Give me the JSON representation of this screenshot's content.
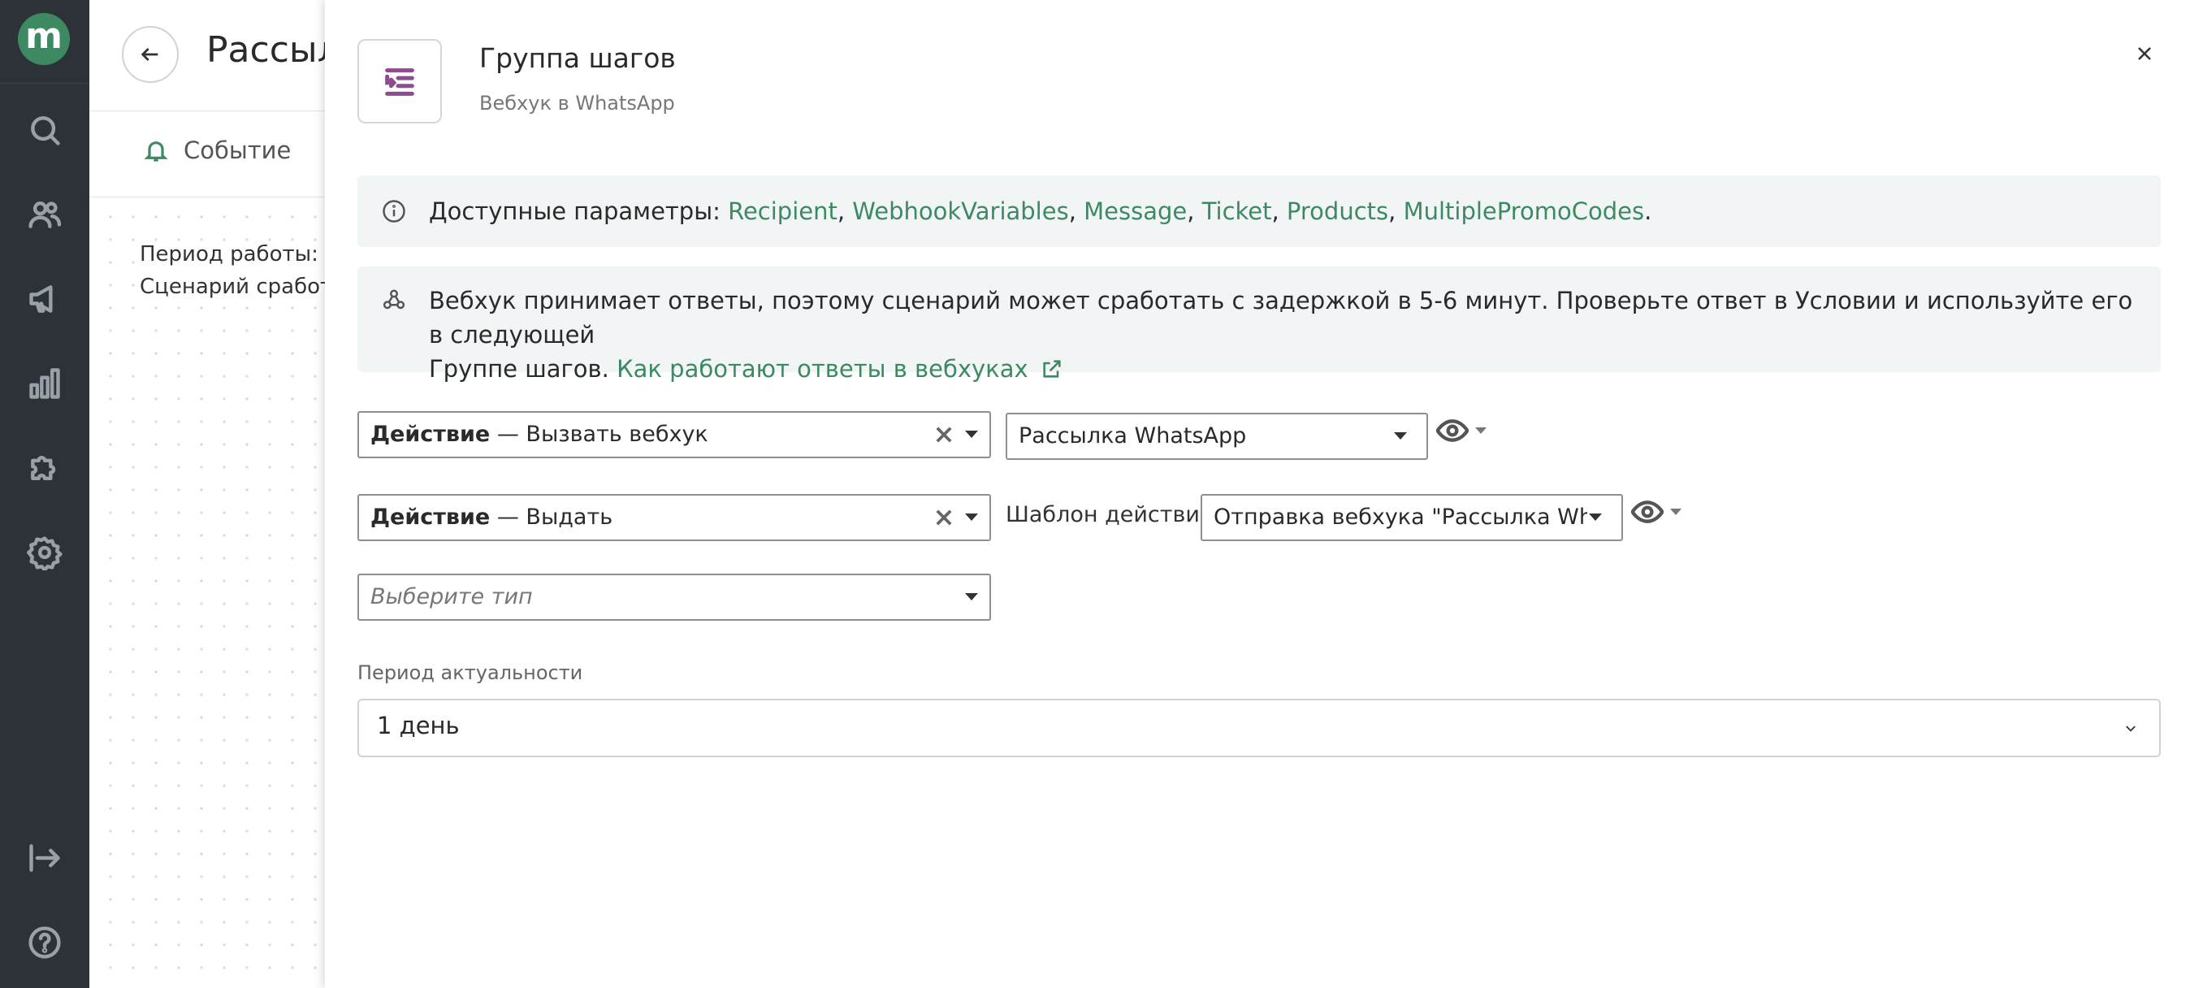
{
  "app": {
    "logo_letter": "m"
  },
  "background_page": {
    "title": "Рассыл",
    "tab_event": "Событие",
    "line1": "Период работы: ср",
    "line2": "Сценарий сработае"
  },
  "drawer": {
    "title": "Группа шагов",
    "subtitle": "Вебхук в WhatsApp",
    "info_params": {
      "prefix": "Доступные параметры: ",
      "params": [
        "Recipient",
        "WebhookVariables",
        "Message",
        "Ticket",
        "Products",
        "MultiplePromoCodes"
      ],
      "end": "."
    },
    "info_webhook": {
      "line1": "Вебхук принимает ответы, поэтому сценарий может сработать с задержкой в 5-6 минут. Проверьте ответ в Условии и используйте его в следующей",
      "line2_prefix": "Группе шагов. ",
      "link": "Как работают ответы в вебхуках"
    },
    "row1": {
      "bold": "Действие",
      "rest": " — Вызвать вебхук",
      "second_select": "Рассылка WhatsApp"
    },
    "row2": {
      "bold": "Действие",
      "rest": " — Выдать",
      "template_label": "Шаблон действия",
      "template_select": "Отправка вебхука \"Рассылка What..."
    },
    "row3": {
      "placeholder": "Выберите тип"
    },
    "period": {
      "label": "Период актуальности",
      "value": "1 день"
    }
  }
}
